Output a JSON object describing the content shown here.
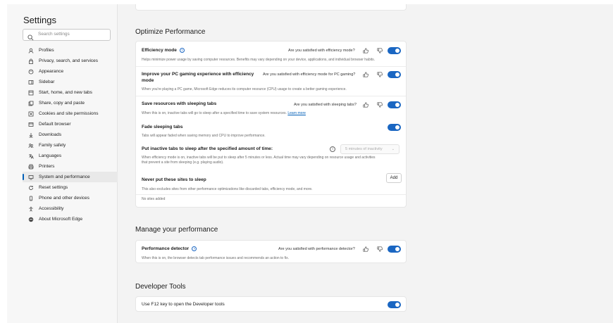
{
  "settings_title": "Settings",
  "search": {
    "placeholder": "Search settings"
  },
  "nav": [
    {
      "label": "Profiles",
      "icon": "profile-icon"
    },
    {
      "label": "Privacy, search, and services",
      "icon": "lock-icon"
    },
    {
      "label": "Appearance",
      "icon": "appearance-icon"
    },
    {
      "label": "Sidebar",
      "icon": "sidebar-icon"
    },
    {
      "label": "Start, home, and new tabs",
      "icon": "home-icon"
    },
    {
      "label": "Share, copy and paste",
      "icon": "share-icon"
    },
    {
      "label": "Cookies and site permissions",
      "icon": "cookie-icon"
    },
    {
      "label": "Default browser",
      "icon": "browser-icon"
    },
    {
      "label": "Downloads",
      "icon": "download-icon"
    },
    {
      "label": "Family safety",
      "icon": "family-icon"
    },
    {
      "label": "Languages",
      "icon": "language-icon"
    },
    {
      "label": "Printers",
      "icon": "printer-icon"
    },
    {
      "label": "System and performance",
      "icon": "system-icon",
      "active": true
    },
    {
      "label": "Reset settings",
      "icon": "reset-icon"
    },
    {
      "label": "Phone and other devices",
      "icon": "phone-icon"
    },
    {
      "label": "Accessibility",
      "icon": "accessibility-icon"
    },
    {
      "label": "About Microsoft Edge",
      "icon": "edge-icon"
    }
  ],
  "optimize": {
    "heading": "Optimize Performance",
    "efficiency": {
      "title": "Efficiency mode",
      "ask": "Are you satisfied with efficiency mode?",
      "desc": "Helps minimize power usage by saving computer resources. Benefits may vary depending on your device, applications, and individual browser habits."
    },
    "gaming": {
      "title": "Improve your PC gaming experience with efficiency mode",
      "ask": "Are you satisfied with efficiency mode for PC gaming?",
      "desc": "When you're playing a PC game, Microsoft Edge reduces its computer resource (CPU) usage to create a better gaming experience."
    },
    "sleeping": {
      "title": "Save resources with sleeping tabs",
      "ask": "Are you satisfied with sleeping tabs?",
      "desc": "When this is on, inactive tabs will go to sleep after a specified time to save system resources.",
      "link": "Learn more"
    },
    "fade": {
      "title": "Fade sleeping tabs",
      "desc": "Tabs will appear faded when saving memory and CPU to improve performance."
    },
    "inactive": {
      "title": "Put inactive tabs to sleep after the specified amount of time:",
      "select": "5 minutes of inactivity",
      "desc": "When efficiency mode is on, inactive tabs will be put to sleep after 5 minutes or less. Actual time may vary depending on resource usage and activities that prevent a site from sleeping (e.g. playing audio)."
    },
    "never": {
      "title": "Never put these sites to sleep",
      "add": "Add",
      "desc": "This also excludes sites from other performance optimizations like discarded tabs, efficiency mode, and more.",
      "empty": "No sites added"
    }
  },
  "manage": {
    "heading": "Manage your performance",
    "detector": {
      "title": "Performance detector",
      "ask": "Are you satisfied with performance detector?",
      "desc": "When this is on, the browser detects tab performance issues and recommends an action to fix."
    }
  },
  "devtools": {
    "heading": "Developer Tools",
    "f12": {
      "title": "Use F12 key to open the Developer tools"
    }
  },
  "colors": {
    "accent": "#1a66c2",
    "link": "#005fb8"
  }
}
